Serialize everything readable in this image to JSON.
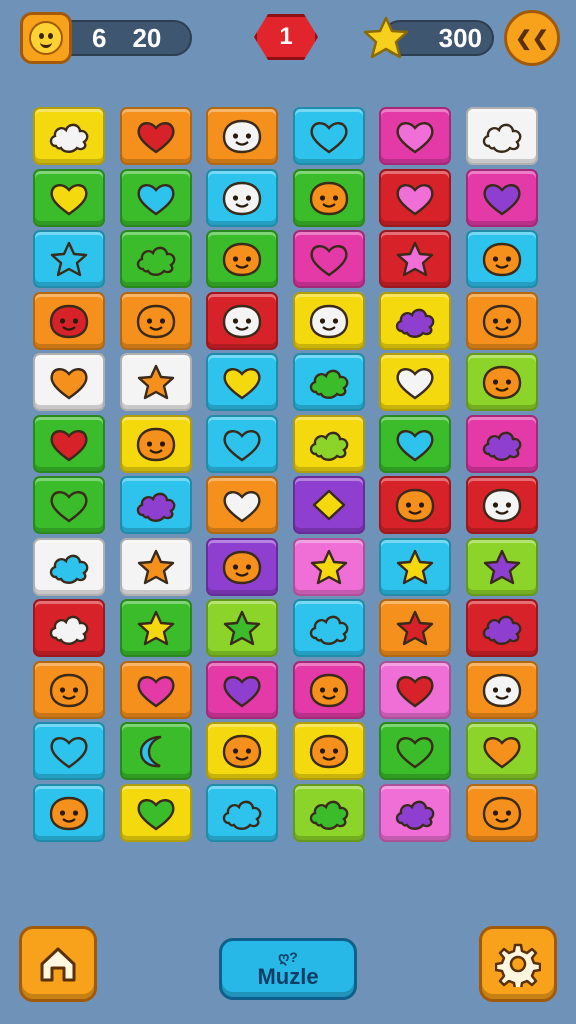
{
  "hud": {
    "moves": "6",
    "target": "20",
    "level": "1",
    "score": "300",
    "round_button_label": "❮❮",
    "avatar_icon": "smiley-face-icon",
    "star_icon": "star-icon"
  },
  "bottom_bar": {
    "puzzle_top": "ღ?",
    "puzzle_bottom": "Muzle",
    "home_icon": "home-icon",
    "settings_icon": "gear-icon"
  },
  "colors": {
    "yellow": "#f5d90f",
    "orange": "#f5901c",
    "cyan": "#2dc3ec",
    "magenta": "#e33aa8",
    "white": "#f4f4f4",
    "green": "#3bbd2b",
    "red": "#d8222a",
    "purple": "#8e3fd0",
    "lime": "#8dd42a",
    "pink": "#ef6fd6"
  },
  "board": {
    "rows": 12,
    "cols": 6,
    "tiles": [
      [
        {
          "bg": "yellow",
          "icon": "cloud",
          "fg": "white"
        },
        {
          "bg": "orange",
          "icon": "heart",
          "fg": "red"
        },
        {
          "bg": "orange",
          "icon": "face",
          "fg": "white"
        },
        {
          "bg": "cyan",
          "icon": "heart",
          "fg": "cyan"
        },
        {
          "bg": "magenta",
          "icon": "heart",
          "fg": "pink"
        },
        {
          "bg": "white",
          "icon": "cloud",
          "fg": "white"
        }
      ],
      [
        {
          "bg": "green",
          "icon": "heart",
          "fg": "yellow"
        },
        {
          "bg": "green",
          "icon": "heart",
          "fg": "cyan"
        },
        {
          "bg": "cyan",
          "icon": "face",
          "fg": "white"
        },
        {
          "bg": "green",
          "icon": "face",
          "fg": "orange"
        },
        {
          "bg": "red",
          "icon": "heart",
          "fg": "pink"
        },
        {
          "bg": "magenta",
          "icon": "heart",
          "fg": "purple"
        }
      ],
      [
        {
          "bg": "cyan",
          "icon": "star",
          "fg": "cyan"
        },
        {
          "bg": "green",
          "icon": "cloud",
          "fg": "green"
        },
        {
          "bg": "green",
          "icon": "face",
          "fg": "orange"
        },
        {
          "bg": "magenta",
          "icon": "heart",
          "fg": "magenta"
        },
        {
          "bg": "red",
          "icon": "star",
          "fg": "pink"
        },
        {
          "bg": "cyan",
          "icon": "face",
          "fg": "orange"
        }
      ],
      [
        {
          "bg": "orange",
          "icon": "face",
          "fg": "red"
        },
        {
          "bg": "orange",
          "icon": "face",
          "fg": "orange"
        },
        {
          "bg": "red",
          "icon": "face",
          "fg": "white"
        },
        {
          "bg": "yellow",
          "icon": "face",
          "fg": "white"
        },
        {
          "bg": "yellow",
          "icon": "cloud",
          "fg": "purple"
        },
        {
          "bg": "orange",
          "icon": "face",
          "fg": "orange"
        }
      ],
      [
        {
          "bg": "white",
          "icon": "heart",
          "fg": "orange"
        },
        {
          "bg": "white",
          "icon": "star",
          "fg": "orange"
        },
        {
          "bg": "cyan",
          "icon": "heart",
          "fg": "yellow"
        },
        {
          "bg": "cyan",
          "icon": "cloud",
          "fg": "green"
        },
        {
          "bg": "yellow",
          "icon": "heart",
          "fg": "white"
        },
        {
          "bg": "lime",
          "icon": "face",
          "fg": "orange"
        }
      ],
      [
        {
          "bg": "green",
          "icon": "heart",
          "fg": "red"
        },
        {
          "bg": "yellow",
          "icon": "face",
          "fg": "orange"
        },
        {
          "bg": "cyan",
          "icon": "heart",
          "fg": "cyan"
        },
        {
          "bg": "yellow",
          "icon": "cloud",
          "fg": "lime"
        },
        {
          "bg": "green",
          "icon": "heart",
          "fg": "cyan"
        },
        {
          "bg": "magenta",
          "icon": "cloud",
          "fg": "purple"
        }
      ],
      [
        {
          "bg": "green",
          "icon": "heart",
          "fg": "green"
        },
        {
          "bg": "cyan",
          "icon": "cloud",
          "fg": "purple"
        },
        {
          "bg": "orange",
          "icon": "heart",
          "fg": "white"
        },
        {
          "bg": "purple",
          "icon": "diamond",
          "fg": "yellow"
        },
        {
          "bg": "red",
          "icon": "face",
          "fg": "orange"
        },
        {
          "bg": "red",
          "icon": "face",
          "fg": "white"
        }
      ],
      [
        {
          "bg": "white",
          "icon": "cloud",
          "fg": "cyan"
        },
        {
          "bg": "white",
          "icon": "star",
          "fg": "orange"
        },
        {
          "bg": "purple",
          "icon": "face",
          "fg": "orange"
        },
        {
          "bg": "pink",
          "icon": "star",
          "fg": "yellow"
        },
        {
          "bg": "cyan",
          "icon": "star",
          "fg": "yellow"
        },
        {
          "bg": "lime",
          "icon": "star",
          "fg": "purple"
        }
      ],
      [
        {
          "bg": "red",
          "icon": "cloud",
          "fg": "white"
        },
        {
          "bg": "green",
          "icon": "star",
          "fg": "yellow"
        },
        {
          "bg": "lime",
          "icon": "star",
          "fg": "green"
        },
        {
          "bg": "cyan",
          "icon": "cloud",
          "fg": "cyan"
        },
        {
          "bg": "orange",
          "icon": "star",
          "fg": "red"
        },
        {
          "bg": "red",
          "icon": "cloud",
          "fg": "purple"
        }
      ],
      [
        {
          "bg": "orange",
          "icon": "face",
          "fg": "orange"
        },
        {
          "bg": "orange",
          "icon": "heart",
          "fg": "magenta"
        },
        {
          "bg": "magenta",
          "icon": "heart",
          "fg": "purple"
        },
        {
          "bg": "magenta",
          "icon": "face",
          "fg": "orange"
        },
        {
          "bg": "pink",
          "icon": "heart",
          "fg": "red"
        },
        {
          "bg": "orange",
          "icon": "face",
          "fg": "white"
        }
      ],
      [
        {
          "bg": "cyan",
          "icon": "heart",
          "fg": "cyan"
        },
        {
          "bg": "green",
          "icon": "moon",
          "fg": "cyan"
        },
        {
          "bg": "yellow",
          "icon": "face",
          "fg": "orange"
        },
        {
          "bg": "yellow",
          "icon": "face",
          "fg": "orange"
        },
        {
          "bg": "green",
          "icon": "heart",
          "fg": "green"
        },
        {
          "bg": "lime",
          "icon": "heart",
          "fg": "orange"
        }
      ],
      [
        {
          "bg": "cyan",
          "icon": "face",
          "fg": "orange"
        },
        {
          "bg": "yellow",
          "icon": "heart",
          "fg": "green"
        },
        {
          "bg": "cyan",
          "icon": "cloud",
          "fg": "cyan"
        },
        {
          "bg": "lime",
          "icon": "cloud",
          "fg": "green"
        },
        {
          "bg": "pink",
          "icon": "cloud",
          "fg": "purple"
        },
        {
          "bg": "orange",
          "icon": "face",
          "fg": "orange"
        }
      ]
    ]
  }
}
